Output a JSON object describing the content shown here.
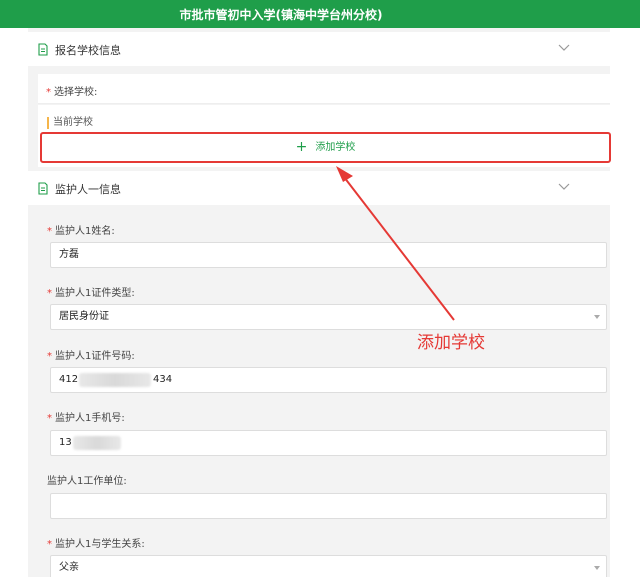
{
  "header": {
    "title": "市批市管初中入学(镇海中学台州分校)"
  },
  "school_section": {
    "title": "报名学校信息",
    "choose_school_label": "选择学校:",
    "current_school_label": "当前学校",
    "add_school_button": "添加学校"
  },
  "guardian_section": {
    "title": "监护人一信息",
    "fields": [
      {
        "label": "监护人1姓名:",
        "value": "方磊",
        "required": true
      },
      {
        "label": "监护人1证件类型:",
        "value": "居民身份证",
        "required": true
      },
      {
        "label": "监护人1证件号码:",
        "value_prefix": "412",
        "value_suffix": "434",
        "required": true
      },
      {
        "label": "监护人1手机号:",
        "value_prefix": "13",
        "required": true
      },
      {
        "label": "监护人1工作单位:",
        "value": "",
        "required": false
      },
      {
        "label": "监护人1与学生关系:",
        "value": "父亲",
        "required": true
      }
    ]
  },
  "annotation": {
    "text": "添加学校"
  },
  "colors": {
    "header_bg": "#1f9e4a",
    "accent_green": "#1f9e4a",
    "required_mark": "#e53935",
    "highlight": "#e53935"
  },
  "icons": {
    "section_icon": "document-icon",
    "collapse_icon": "chevron-down-icon",
    "add_icon": "plus-icon"
  }
}
